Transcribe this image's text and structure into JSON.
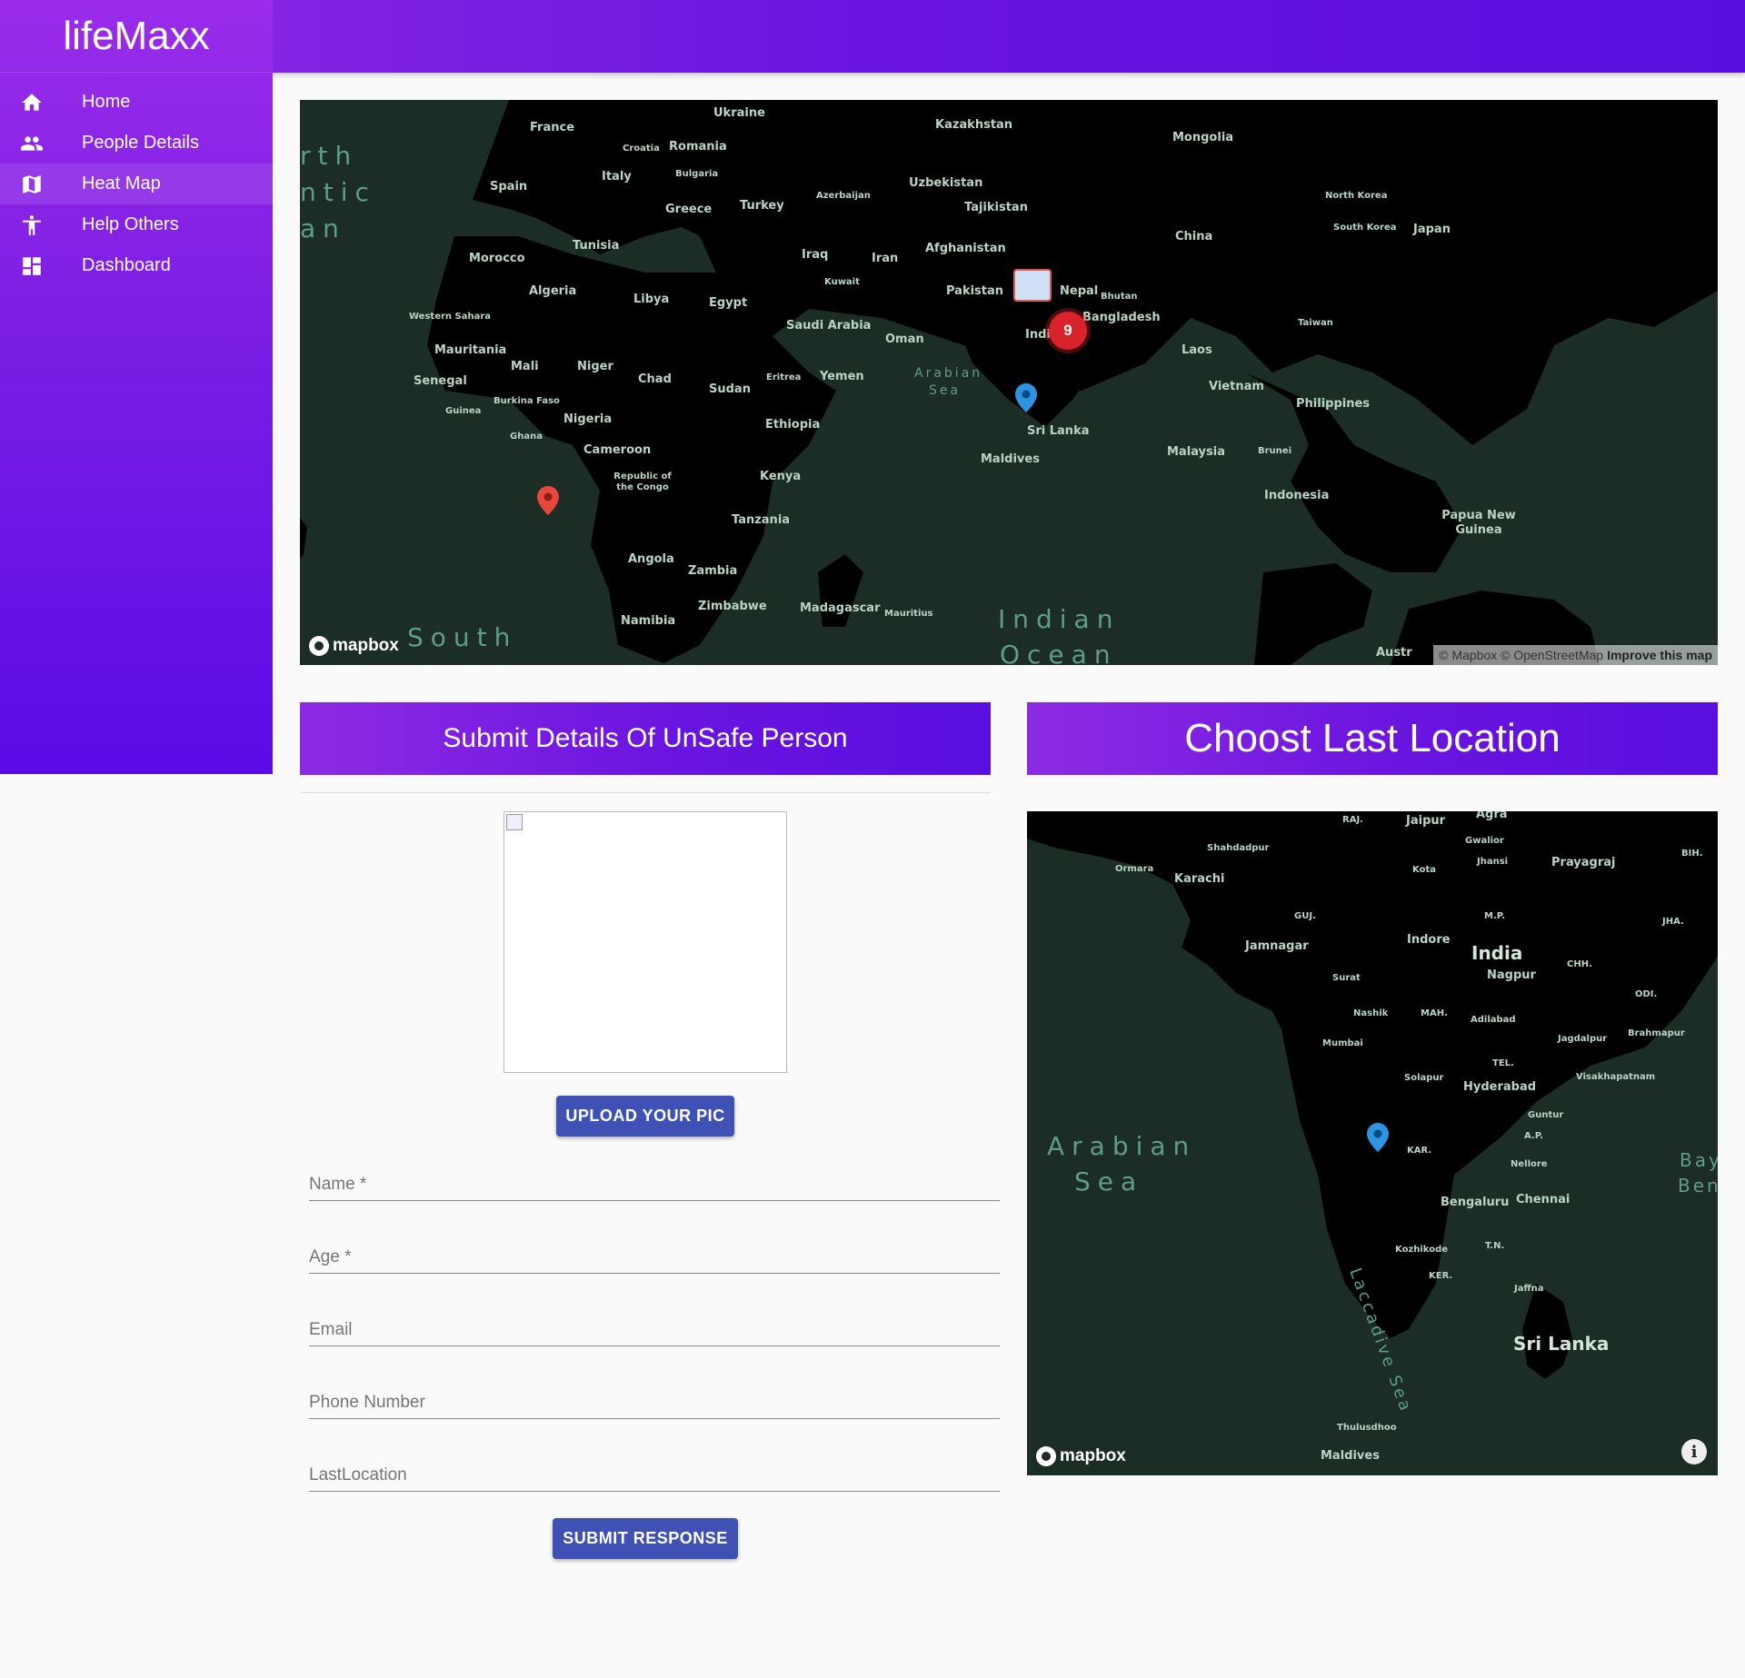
{
  "app": {
    "title": "lifeMaxx"
  },
  "nav": {
    "items": [
      {
        "label": "Home",
        "icon": "home-icon"
      },
      {
        "label": "People Details",
        "icon": "people-icon"
      },
      {
        "label": "Heat Map",
        "icon": "map-icon"
      },
      {
        "label": "Help Others",
        "icon": "accessibility-icon"
      },
      {
        "label": "Dashboard",
        "icon": "dashboard-icon"
      }
    ],
    "active": "Heat Map"
  },
  "heatmap": {
    "oceans": [
      "rth",
      "ntic",
      "an",
      "South",
      "Indian",
      "Ocean",
      "Arabian",
      "Sea"
    ],
    "countries": [
      "Ukraine",
      "Kazakhstan",
      "Mongolia",
      "France",
      "Croatia",
      "Romania",
      "Bulgaria",
      "Italy",
      "Spain",
      "Greece",
      "Turkey",
      "Azerbaijan",
      "Uzbekistan",
      "Tajikistan",
      "North Korea",
      "South Korea",
      "Japan",
      "China",
      "Tunisia",
      "Morocco",
      "Algeria",
      "Libya",
      "Egypt",
      "Iraq",
      "Iran",
      "Afghanistan",
      "Kuwait",
      "Pakistan",
      "Nepal",
      "Bhutan",
      "Western Sahara",
      "Saudi Arabia",
      "Oman",
      "India",
      "Bangladesh",
      "Taiwan",
      "Mauritania",
      "Mali",
      "Niger",
      "Chad",
      "Sudan",
      "Eritrea",
      "Yemen",
      "Laos",
      "Senegal",
      "Burkina Faso",
      "Guinea",
      "Ghana",
      "Nigeria",
      "Ethiopia",
      "Vietnam",
      "Philippines",
      "Sri Lanka",
      "Cameroon",
      "Maldives",
      "Malaysia",
      "Brunei",
      "Republic of the Congo",
      "Kenya",
      "Indonesia",
      "Tanzania",
      "Papua New Guinea",
      "Angola",
      "Zambia",
      "Zimbabwe",
      "Madagascar",
      "Mauritius",
      "Namibia",
      "Austr"
    ],
    "cluster_count": "9",
    "logo": "mapbox",
    "attribution": "© Mapbox © OpenStreetMap",
    "improve": "Improve this map"
  },
  "form_section": {
    "title": "Submit Details Of UnSafe Person",
    "upload_label": "UPLOAD YOUR PIC",
    "fields": {
      "name": "Name *",
      "age": "Age *",
      "email": "Email",
      "phone": "Phone Number",
      "last_location": "LastLocation"
    },
    "submit_label": "SUBMIT RESPONSE"
  },
  "location_section": {
    "title": "Choost Last Location",
    "labels": [
      "RAJ.",
      "Jaipur",
      "Agra",
      "Gwalior",
      "Shahdadpur",
      "Jhansi",
      "Prayagraj",
      "BIH.",
      "Ormara",
      "Karachi",
      "Kota",
      "GUJ.",
      "M.P.",
      "JHA.",
      "Jamnagar",
      "Indore",
      "India",
      "Nagpur",
      "CHH.",
      "Surat",
      "ODI.",
      "Nashik",
      "MAH.",
      "Adilabad",
      "Jagdalpur",
      "Brahmapur",
      "Mumbai",
      "TEL.",
      "Solapur",
      "Hyderabad",
      "Visakhapatnam",
      "Guntur",
      "A.P.",
      "KAR.",
      "Nellore",
      "Bengaluru",
      "Chennai",
      "T.N.",
      "Kozhikode",
      "KER.",
      "Jaffna",
      "Sri Lanka",
      "Thulusdhoo",
      "Maldives"
    ],
    "oceans": [
      "Arabian",
      "Sea",
      "Bay",
      "Ben",
      "Laccadive Sea"
    ],
    "logo": "mapbox"
  }
}
